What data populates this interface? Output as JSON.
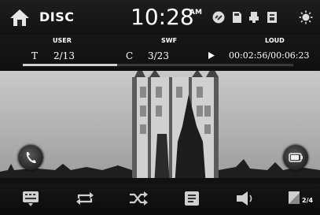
{
  "header": {
    "source": "DISC",
    "time": "10:28",
    "ampm": "AM"
  },
  "info": {
    "user_label": "USER",
    "swf_label": "SWF",
    "loud_label": "LOUD",
    "track_prefix": "T",
    "track": "2/13",
    "chapter_prefix": "C",
    "chapter": "3/23",
    "elapsed_total": "00:02:56/00:06:23",
    "progress_fraction": 0.35
  },
  "footer": {
    "page": "2/4"
  },
  "colors": {
    "bar": "#141414",
    "accent": "#ffffff",
    "progress": "#cfcfcf"
  },
  "icons": [
    "home-icon",
    "link-icon",
    "sd-card-icon",
    "usb-icon",
    "disc-file-icon",
    "brightness-icon",
    "phone-icon",
    "battery-icon",
    "keyboard-icon",
    "repeat-icon",
    "shuffle-icon",
    "list-icon",
    "speaker-icon",
    "page-icon"
  ]
}
